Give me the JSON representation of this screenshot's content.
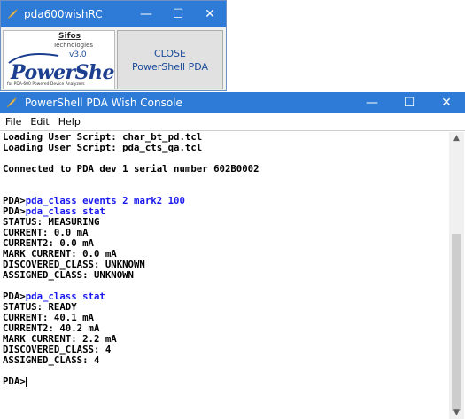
{
  "launcher": {
    "title": "pda600wishRC",
    "minimize": "—",
    "maximize": "☐",
    "close": "✕",
    "logo": {
      "brand": "Sifos",
      "sub": "Technologies",
      "version": "v3.0",
      "product": "PowerShell",
      "tagline": "for PDA-600 Powered Device Analyzers"
    },
    "close_button": {
      "line1": "CLOSE",
      "line2": "PowerShell PDA"
    }
  },
  "console_window": {
    "title": "PowerShell PDA Wish Console",
    "minimize": "—",
    "maximize": "☐",
    "close": "✕",
    "menu": {
      "file": "File",
      "edit": "Edit",
      "help": "Help"
    },
    "lines": [
      {
        "text": "Loading User Script: char_bt_pd.tcl"
      },
      {
        "text": "Loading User Script: pda_cts_qa.tcl"
      },
      {
        "text": ""
      },
      {
        "text": "Connected to PDA dev 1 serial number 602B0002"
      },
      {
        "text": ""
      },
      {
        "text": ""
      },
      {
        "prompt": "PDA>",
        "cmd": "pda_class events 2 mark2 100"
      },
      {
        "prompt": "PDA>",
        "cmd": "pda_class stat"
      },
      {
        "text": "STATUS: MEASURING"
      },
      {
        "text": "CURRENT: 0.0 mA"
      },
      {
        "text": "CURRENT2: 0.0 mA"
      },
      {
        "text": "MARK CURRENT: 0.0 mA"
      },
      {
        "text": "DISCOVERED_CLASS: UNKNOWN"
      },
      {
        "text": "ASSIGNED_CLASS: UNKNOWN"
      },
      {
        "text": ""
      },
      {
        "prompt": "PDA>",
        "cmd": "pda_class stat"
      },
      {
        "text": "STATUS: READY"
      },
      {
        "text": "CURRENT: 40.1 mA"
      },
      {
        "text": "CURRENT2: 40.2 mA"
      },
      {
        "text": "MARK CURRENT: 2.2 mA"
      },
      {
        "text": "DISCOVERED_CLASS: 4"
      },
      {
        "text": "ASSIGNED_CLASS: 4"
      },
      {
        "text": ""
      },
      {
        "prompt": "PDA>",
        "cmd": ""
      }
    ],
    "scroll_up": "▲",
    "scroll_down": "▼"
  }
}
